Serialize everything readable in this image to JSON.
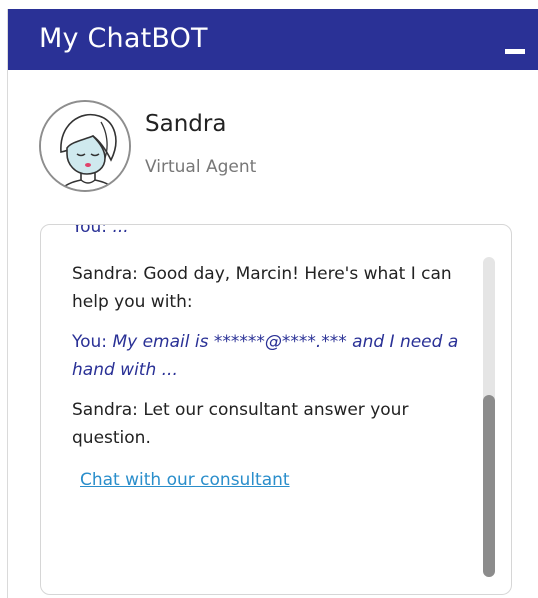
{
  "header": {
    "title": "My ChatBOT",
    "minimize_icon": "minimize-icon"
  },
  "agent": {
    "avatar_icon": "agent-avatar-illustration",
    "name": "Sandra",
    "role": "Virtual Agent"
  },
  "messages": [
    {
      "speaker": "You:",
      "text": "...",
      "from": "user",
      "clipped": true
    },
    {
      "speaker": "Sandra:",
      "text": "Good day, Marcin! Here's what I can help you with:",
      "from": "agent"
    },
    {
      "speaker": "You:",
      "text": "My email is ******@****.*** and I need a hand with ...",
      "from": "user"
    },
    {
      "speaker": "Sandra:",
      "text": "Let our consultant answer your question.",
      "from": "agent"
    }
  ],
  "link": {
    "label": "Chat with our consultant"
  },
  "colors": {
    "header_bg": "#2a3196",
    "user_text": "#2a3196",
    "link": "#2a8ecb",
    "scrollbar_thumb": "#8c8c8c"
  }
}
